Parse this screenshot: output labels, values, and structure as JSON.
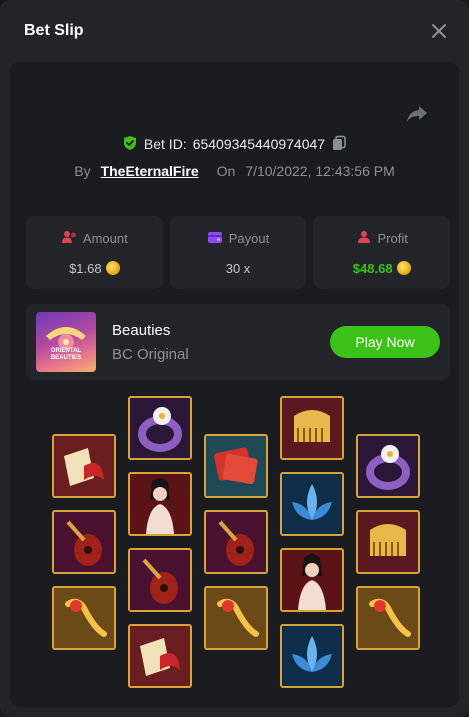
{
  "header": {
    "title": "Bet Slip",
    "close_icon": "close-icon"
  },
  "bet": {
    "id_label": "Bet ID:",
    "id_value": "65409345440974047",
    "by_label": "By",
    "username": "TheEternalFire",
    "on_label": "On",
    "datetime": "7/10/2022, 12:43:56 PM"
  },
  "stats": {
    "amount": {
      "label": "Amount",
      "value": "$1.68"
    },
    "payout": {
      "label": "Payout",
      "value": "30 x"
    },
    "profit": {
      "label": "Profit",
      "value": "$48.68"
    }
  },
  "game": {
    "name": "Beauties",
    "provider": "BC Original",
    "play_label": "Play Now",
    "thumb_text_1": "ORIENTAL",
    "thumb_text_2": "BEAUTIES"
  },
  "reels": [
    [
      "fan",
      "pipa",
      "hairpin"
    ],
    [
      "ring",
      "lady",
      "pipa",
      "fan"
    ],
    [
      "envelope",
      "pipa",
      "hairpin"
    ],
    [
      "comb",
      "lotus",
      "lady",
      "lotus"
    ],
    [
      "ring",
      "comb",
      "hairpin"
    ]
  ],
  "colors": {
    "accent_green": "#3bc117",
    "tile_border": "#d6a43a",
    "amount_icon": "#e2415a",
    "payout_icon": "#8b4dff",
    "profit_icon": "#e2415a"
  }
}
